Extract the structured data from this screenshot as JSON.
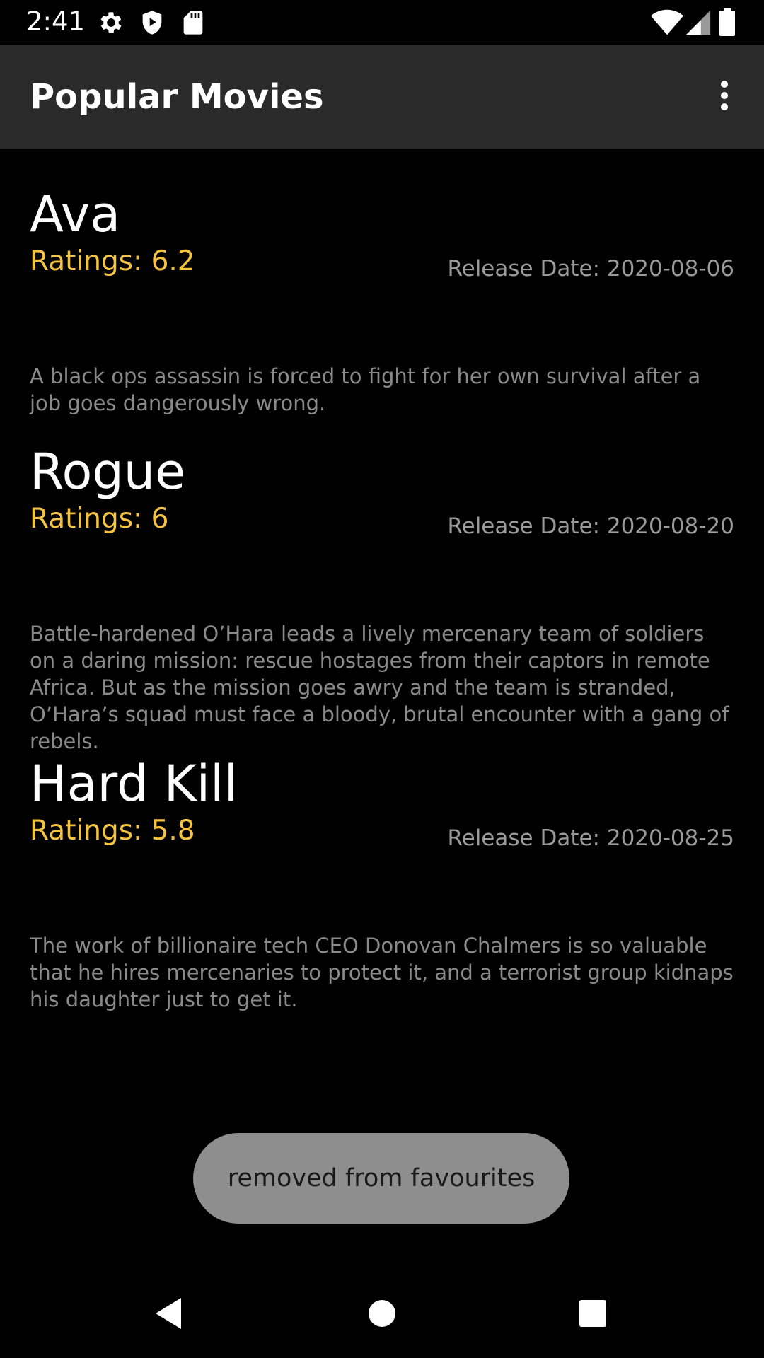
{
  "status_bar": {
    "time": "2:41",
    "left_icons": [
      "gear-icon",
      "shield-play-icon",
      "sd-card-icon"
    ],
    "right_icons": [
      "wifi-icon",
      "signal-icon",
      "battery-icon"
    ]
  },
  "app_bar": {
    "title": "Popular Movies",
    "menu_icon": "more-vert-icon"
  },
  "movies": [
    {
      "title": "Ava",
      "rating": "Ratings: 6.2",
      "release": "Release Date: 2020-08-06",
      "overview": "A black ops assassin is forced to fight for her own survival after a job goes dangerously wrong."
    },
    {
      "title": "Rogue",
      "rating": "Ratings: 6",
      "release": "Release Date: 2020-08-20",
      "overview": "Battle-hardened O’Hara leads a lively mercenary team of soldiers on a daring mission: rescue hostages from their captors in remote Africa. But as the mission goes awry and the team is stranded, O’Hara’s squad must face a bloody, brutal encounter with a gang of rebels."
    },
    {
      "title": "Hard Kill",
      "rating": "Ratings: 5.8",
      "release": "Release Date: 2020-08-25",
      "overview": "The work of billionaire tech CEO Donovan Chalmers is so valuable that he hires mercenaries to protect it, and a terrorist group kidnaps his daughter just to get it."
    }
  ],
  "toast": {
    "text": "removed from favourites"
  },
  "nav_bar": {
    "buttons": [
      "back-icon",
      "home-icon",
      "recents-icon"
    ]
  },
  "colors": {
    "background": "#000000",
    "app_bar": "#2a2a2a",
    "rating": "#f5c342",
    "secondary_text": "#9a9a9a",
    "toast": "#8e8e8e"
  }
}
